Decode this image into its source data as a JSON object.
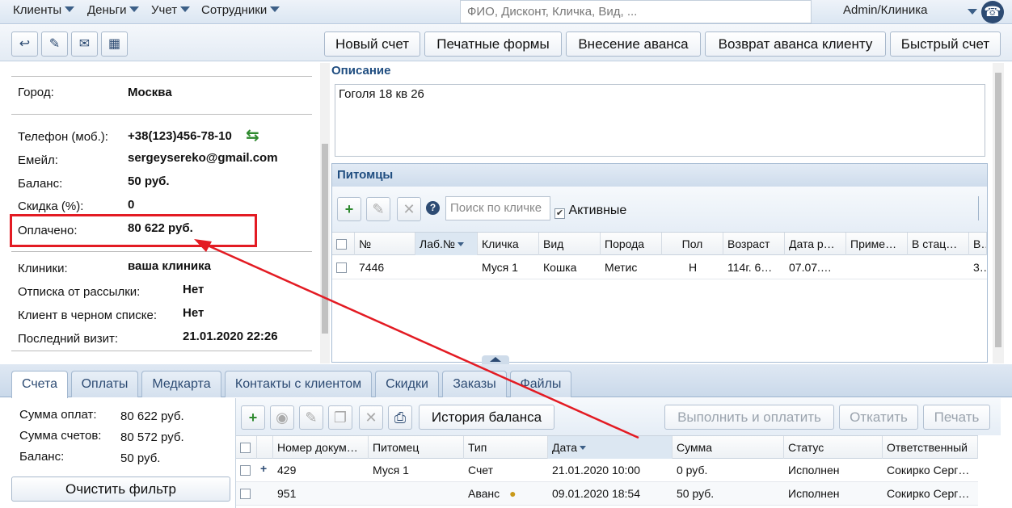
{
  "topmenu": {
    "items": [
      "Клиенты",
      "Деньги",
      "Учет",
      "Сотрудники"
    ],
    "search_placeholder": "ФИО, Дисконт, Кличка, Вид, ...",
    "user": "Admin/Клиника",
    "support_icon": "headset-icon"
  },
  "toolbar": {
    "icons": [
      "back-icon",
      "edit-icon",
      "mail-icon",
      "calendar-icon"
    ],
    "buttons": [
      "Новый счет",
      "Печатные формы",
      "Внесение аванса",
      "Возврат аванса клиенту",
      "Быстрый счет"
    ]
  },
  "client": {
    "city_label": "Город:",
    "city": "Москва",
    "phone_label": "Телефон (моб.):",
    "phone": "+38(123)456-78-10",
    "email_label": "Емейл:",
    "email": "sergeysereko@gmail.com",
    "balance_label": "Баланс:",
    "balance": "50 руб.",
    "discount_label": "Скидка (%):",
    "discount": "0",
    "paid_label": "Оплачено:",
    "paid": "80 622 руб.",
    "clinics_label": "Клиники:",
    "clinics": "ваша клиника",
    "unsub_label": "Отписка от рассылки:",
    "unsub": "Нет",
    "blacklist_label": "Клиент в черном списке:",
    "blacklist": "Нет",
    "lastvisit_label": "Последний визит:",
    "lastvisit": "21.01.2020 22:26"
  },
  "description": {
    "title": "Описание",
    "text": "Гоголя 18 кв 26"
  },
  "pets": {
    "title": "Питомцы",
    "search_placeholder": "Поиск по кличке",
    "active_label": "Активные",
    "columns": [
      "№",
      "Лаб.№",
      "Кличка",
      "Вид",
      "Порода",
      "Пол",
      "Возраст",
      "Дата р…",
      "Приме…",
      "В стац…",
      "В…"
    ],
    "rows": [
      [
        "7446",
        "",
        "Муся 1",
        "Кошка",
        "Метис",
        "Н",
        "114г. 6…",
        "07.07.…",
        "",
        "",
        "3…"
      ]
    ]
  },
  "tabs": [
    "Счета",
    "Оплаты",
    "Медкарта",
    "Контакты с клиентом",
    "Скидки",
    "Заказы",
    "Файлы"
  ],
  "summary": {
    "paid_label": "Сумма оплат:",
    "paid": "80 622 руб.",
    "bills_label": "Сумма счетов:",
    "bills": "80 572 руб.",
    "balance_label": "Баланс:",
    "balance": "50 руб.",
    "clear_button": "Очистить фильтр"
  },
  "invoices": {
    "history_button": "История баланса",
    "pay_button": "Выполнить и оплатить",
    "rollback_button": "Откатить",
    "print_button": "Печать",
    "columns": [
      "Номер докум…",
      "Питомец",
      "Тип",
      "Дата",
      "Сумма",
      "Статус",
      "Ответственный"
    ],
    "rows": [
      [
        "429",
        "Муся 1",
        "Счет",
        "21.01.2020 10:00",
        "0 руб.",
        "Исполнен",
        "Сокирко Серг…"
      ],
      [
        "951",
        "",
        "Аванс",
        "09.01.2020 18:54",
        "50 руб.",
        "Исполнен",
        "Сокирко Серг…"
      ]
    ]
  },
  "colors": {
    "accent": "#2d4b73",
    "annotation": "#e31b23",
    "green": "#2f8a2f"
  }
}
